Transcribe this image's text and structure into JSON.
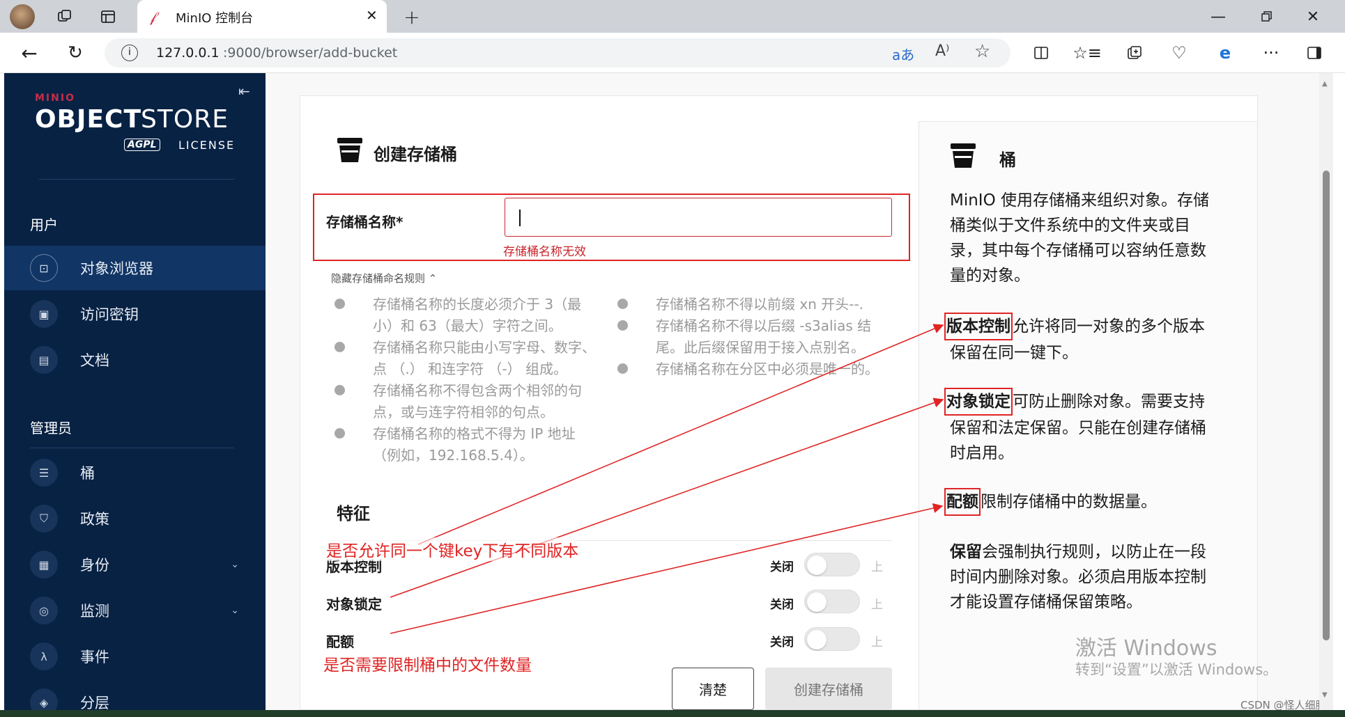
{
  "browser": {
    "tab_title": "MinIO 控制台",
    "url_host": "127.0.0.1",
    "url_path": ":9000/browser/add-bucket"
  },
  "sidebar": {
    "logo_brand": "MINIO",
    "logo_product_bold": "OBJECT",
    "logo_product_light": "STORE",
    "logo_license_badge": "AGPL",
    "logo_license_text": "LICENSE",
    "user_section": "用户",
    "user_items": [
      {
        "label": "对象浏览器",
        "icon": "object-browser-icon",
        "active": true
      },
      {
        "label": "访问密钥",
        "icon": "access-keys-icon"
      },
      {
        "label": "文档",
        "icon": "documentation-icon"
      }
    ],
    "admin_section": "管理员",
    "admin_items": [
      {
        "label": "桶",
        "icon": "bucket-icon"
      },
      {
        "label": "政策",
        "icon": "policy-icon"
      },
      {
        "label": "身份",
        "icon": "identity-icon",
        "expandable": true
      },
      {
        "label": "监测",
        "icon": "monitoring-icon",
        "expandable": true
      },
      {
        "label": "事件",
        "icon": "events-icon"
      },
      {
        "label": "分层",
        "icon": "tiering-icon"
      }
    ]
  },
  "form": {
    "title": "创建存储桶",
    "bucket_name_label": "存储桶名称*",
    "bucket_name_value": "",
    "error": "存储桶名称无效",
    "rules_toggle": "隐藏存储桶命名规则",
    "rules_left": [
      [
        "存储桶名称的长度必须介于 3（最",
        "小）和 63（最大）字符之间。"
      ],
      [
        "存储桶名称只能由小写字母、数字、",
        "点 （.） 和连字符 （-） 组成。"
      ],
      [
        "存储桶名称不得包含两个相邻的句",
        "点，或与连字符相邻的句点。"
      ],
      [
        "存储桶名称的格式不得为 IP 地址",
        "（例如，192.168.5.4）。"
      ]
    ],
    "rules_right": [
      [
        "存储桶名称不得以前缀 xn 开头--."
      ],
      [
        "存储桶名称不得以后缀 -s3alias 结",
        "尾。此后缀保留用于接入点别名。"
      ],
      [
        "存储桶名称在分区中必须是唯一的。"
      ]
    ],
    "features_title": "特征",
    "features": [
      {
        "label": "版本控制",
        "state": "关闭",
        "on_label": "上"
      },
      {
        "label": "对象锁定",
        "state": "关闭",
        "on_label": "上"
      },
      {
        "label": "配额",
        "state": "关闭",
        "on_label": "上"
      }
    ],
    "clear_button": "清楚",
    "create_button": "创建存储桶"
  },
  "help": {
    "title": "桶",
    "intro": [
      "MinIO 使用存储桶来组织对象。存储",
      "桶类似于文件系统中的文件夹或目",
      "录，其中每个存储桶可以容纳任意数",
      "量的对象。"
    ],
    "versioning_term": "版本控制",
    "versioning_text": [
      "允许将同一对象的多个版本",
      "保留在同一键下。"
    ],
    "lock_term": "对象锁定",
    "lock_text": [
      "可防止删除对象。需要支持",
      "保留和法定保留。只能在创建存储桶",
      "时启用。"
    ],
    "quota_term": "配额",
    "quota_text": "限制存储桶中的数据量。",
    "retention_term": "保留",
    "retention_text": [
      "会强制执行规则，以防止在一段",
      "时间内删除对象。必须启用版本控制",
      "才能设置存储桶保留策略。"
    ]
  },
  "annotations": {
    "versioning_note": "是否允许同一个键key下有不同版本",
    "quota_note": "是否需要限制桶中的文件数量"
  },
  "watermark": {
    "line1": "激活 Windows",
    "line2": "转到“设置”以激活 Windows。",
    "credit": "CSDN @怪人细胞"
  },
  "colors": {
    "sidebar_bg": "#082244",
    "accent_red": "#e02424",
    "error_red": "#c9252c"
  }
}
